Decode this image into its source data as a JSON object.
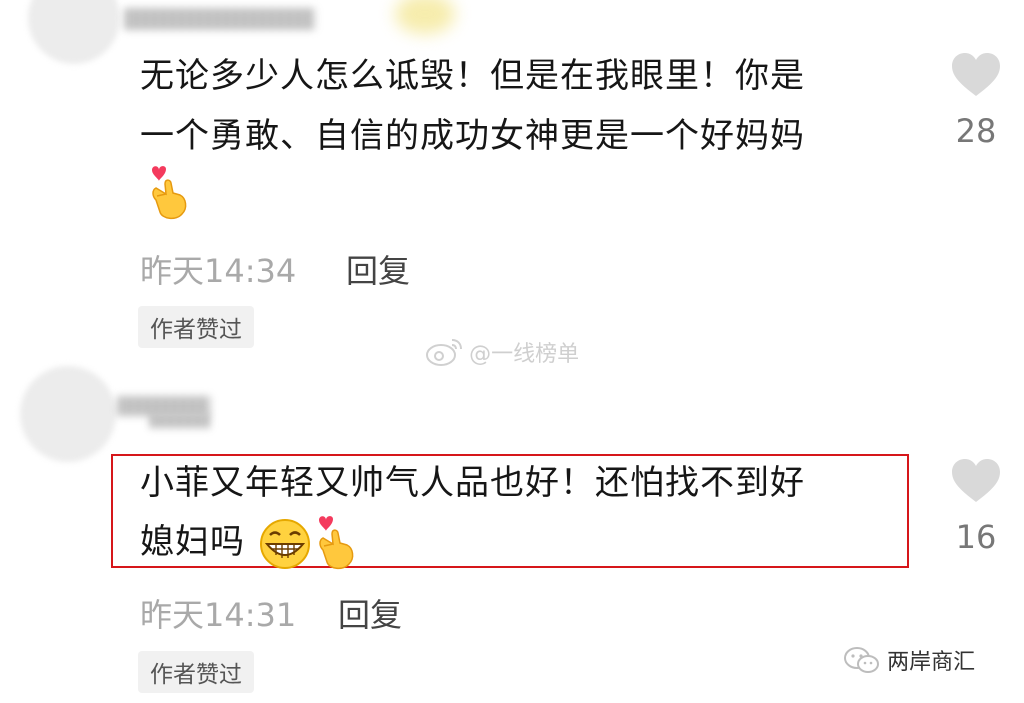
{
  "comments": [
    {
      "line1": "无论多少人怎么诋毁！但是在我眼里！你是",
      "line2": "一个勇敢、自信的成功女神更是一个好妈妈",
      "time": "昨天14:34",
      "reply": "回复",
      "author_liked": "作者赞过",
      "likes": "28"
    },
    {
      "line1": "小菲又年轻又帅气人品也好！还怕找不到好",
      "line2": "媳妇吗",
      "time": "昨天14:31",
      "reply": "回复",
      "author_liked": "作者赞过",
      "likes": "16"
    }
  ],
  "watermarks": {
    "weibo": "@一线榜单",
    "wechat": "两岸商汇"
  },
  "colors": {
    "highlight_border": "#d6161a",
    "heart": "#d9d9d9"
  },
  "icons": [
    "heart-icon",
    "finger-heart-emoji",
    "grin-emoji",
    "weibo-icon",
    "wechat-icon"
  ]
}
